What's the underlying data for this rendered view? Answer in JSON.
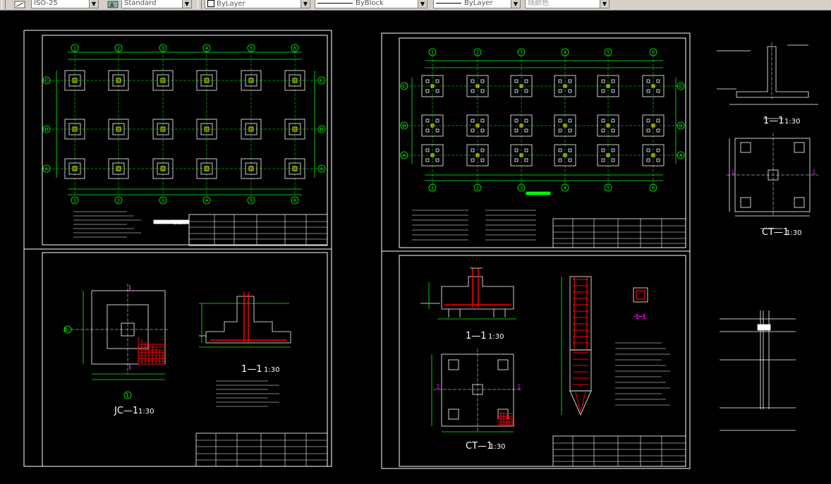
{
  "toolbar": {
    "dimstyle": "ISO-25",
    "textstyle": "Standard",
    "layer": "ByLayer",
    "linetype": "ByBlock",
    "lineweight": "ByLayer",
    "plotstyle": "随颜色"
  },
  "grid_labels": {
    "columns": [
      "1",
      "2",
      "3",
      "4",
      "5",
      "6"
    ],
    "rows": [
      "C",
      "B",
      "A"
    ]
  },
  "drawings": {
    "plan_scale": "1:100",
    "jc_label": "JC—1",
    "jc_scale": "1:30",
    "section_label": "1—1",
    "section_scale": "1:30",
    "ct_label": "CT—1",
    "ct_scale": "1:30",
    "mark_1": "1",
    "mark_a": "A",
    "pile_label": "1-1"
  },
  "colors": {
    "background": "#000000",
    "frame": "#ffffff",
    "gridline": "#00ff00",
    "rebar": "#ff0000",
    "pile": "#ffff00",
    "section_mark": "#ff00ff"
  }
}
